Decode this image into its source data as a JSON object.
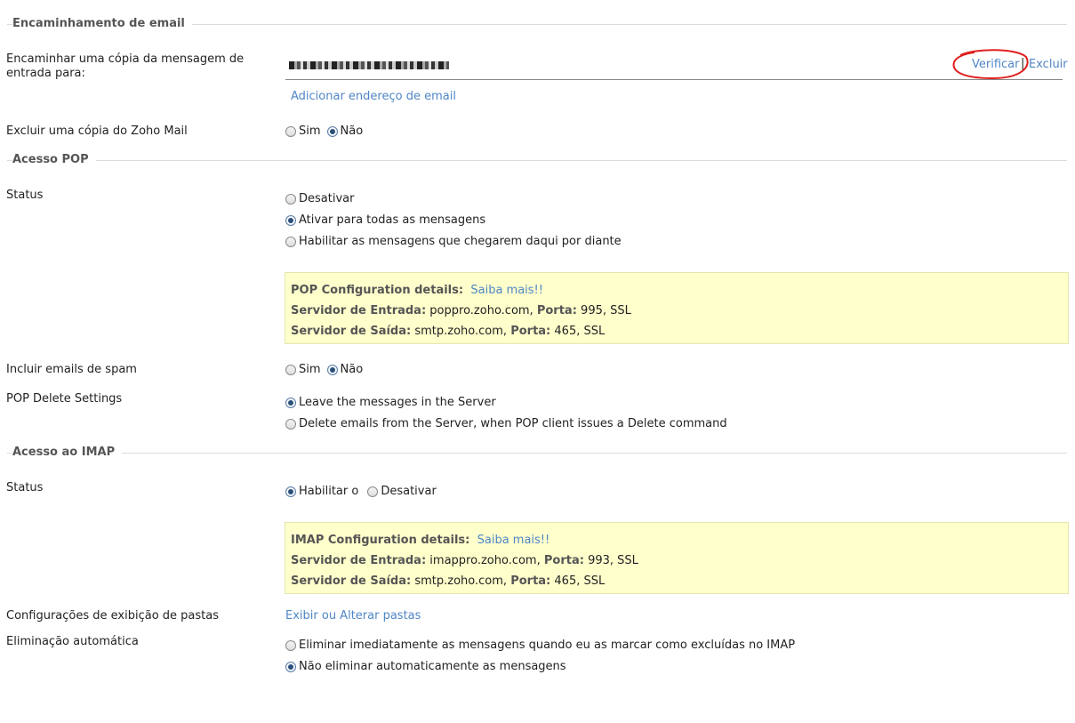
{
  "forwarding": {
    "section_title": "Encaminhamento de email",
    "forward_label_line1": "Encaminhar uma cópia da mensagem de",
    "forward_label_line2": "entrada para:",
    "verify_link": "Verificar",
    "separator": "|",
    "delete_link": "Excluir",
    "add_email_link": "Adicionar endereço de email",
    "delete_copy_label": "Excluir uma cópia do Zoho Mail",
    "delete_copy_options": [
      "Sim",
      "Não"
    ],
    "delete_copy_selected": "Não"
  },
  "pop": {
    "section_title": "Acesso POP",
    "status_label": "Status",
    "status_options": [
      "Desativar",
      "Ativar para todas as mensagens",
      "Habilitar as mensagens que chegarem daqui por diante"
    ],
    "status_selected": "Ativar para todas as mensagens",
    "config_title": "POP Configuration details:",
    "config_link": "Saiba mais!!",
    "incoming_label": "Servidor de Entrada:",
    "incoming_server": "poppro.zoho.com,",
    "incoming_port_label": "Porta:",
    "incoming_port": "995, SSL",
    "outgoing_label": "Servidor de Saída:",
    "outgoing_server": "smtp.zoho.com,",
    "outgoing_port_label": "Porta:",
    "outgoing_port": "465, SSL",
    "spam_label": "Incluir emails de spam",
    "spam_options": [
      "Sim",
      "Não"
    ],
    "spam_selected": "Não",
    "delete_settings_label": "POP Delete Settings",
    "delete_settings_options": [
      "Leave the messages in the Server",
      "Delete emails from the Server, when POP client issues a Delete command"
    ],
    "delete_settings_selected": "Leave the messages in the Server"
  },
  "imap": {
    "section_title": "Acesso ao IMAP",
    "status_label": "Status",
    "status_options": [
      "Habilitar o",
      "Desativar"
    ],
    "status_selected": "Habilitar o",
    "config_title": "IMAP Configuration details:",
    "config_link": "Saiba mais!!",
    "incoming_label": "Servidor de Entrada:",
    "incoming_server": "imappro.zoho.com,",
    "incoming_port_label": "Porta:",
    "incoming_port": "993, SSL",
    "outgoing_label": "Servidor de Saída:",
    "outgoing_server": "smtp.zoho.com,",
    "outgoing_port_label": "Porta:",
    "outgoing_port": "465, SSL",
    "folders_label": "Configurações de exibição de pastas",
    "folders_link": "Exibir ou Alterar pastas",
    "auto_delete_label": "Eliminação automática",
    "auto_delete_options": [
      "Eliminar imediatamente as mensagens quando eu as marcar como excluídas no IMAP",
      "Não eliminar automaticamente as mensagens"
    ],
    "auto_delete_selected": "Não eliminar automaticamente as mensagens"
  },
  "colors": {
    "link": "#4f86c6",
    "info_box": "#ffffcc",
    "annotation": "#e0201e"
  }
}
